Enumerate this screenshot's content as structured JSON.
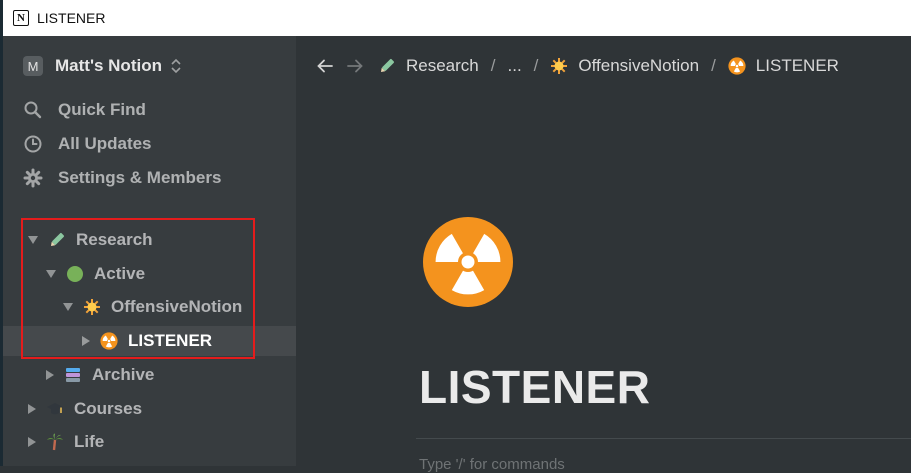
{
  "window": {
    "title": "LISTENER",
    "app_icon_letter": "N"
  },
  "sidebar": {
    "workspace": {
      "avatar": "M",
      "name": "Matt's Notion"
    },
    "nav": [
      {
        "label": "Quick Find",
        "icon": "search-icon"
      },
      {
        "label": "All Updates",
        "icon": "clock-icon"
      },
      {
        "label": "Settings & Members",
        "icon": "gear-icon"
      }
    ],
    "tree": [
      {
        "label": "Research",
        "icon": "pencil-emoji",
        "expanded": true,
        "depth": 0
      },
      {
        "label": "Active",
        "icon": "green-circle-emoji",
        "expanded": true,
        "depth": 1
      },
      {
        "label": "OffensiveNotion",
        "icon": "sun-emoji",
        "expanded": true,
        "depth": 2
      },
      {
        "label": "LISTENER",
        "icon": "radioactive-emoji",
        "expanded": false,
        "depth": 3,
        "selected": true
      },
      {
        "label": "Archive",
        "icon": "books-emoji",
        "expanded": false,
        "depth": 1
      },
      {
        "label": "Courses",
        "icon": "graduation-cap-emoji",
        "expanded": false,
        "depth": 0
      },
      {
        "label": "Life",
        "icon": "palm-tree-emoji",
        "expanded": false,
        "depth": 0
      }
    ]
  },
  "breadcrumb": {
    "items": [
      {
        "label": "Research",
        "icon": "pencil-emoji"
      },
      {
        "label": "...",
        "icon": ""
      },
      {
        "label": "OffensiveNotion",
        "icon": "sun-emoji"
      },
      {
        "label": "LISTENER",
        "icon": "radioactive-emoji"
      }
    ],
    "separator": "/"
  },
  "page": {
    "title": "LISTENER",
    "icon": "radioactive-icon",
    "body_placeholder": "Type '/' for commands"
  },
  "colors": {
    "sidebar_bg": "#373c3f",
    "main_bg": "#2f3437",
    "selected_row": "#45494c",
    "highlight_box": "#e41c1c",
    "radioactive_orange": "#f4931e"
  }
}
